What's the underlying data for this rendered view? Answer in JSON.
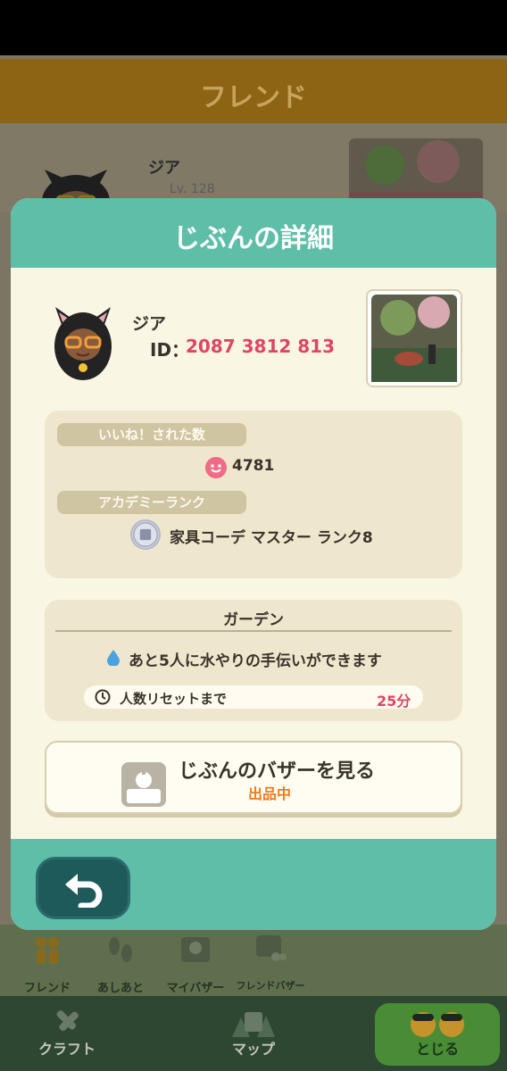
{
  "background": {
    "header_title": "フレンド",
    "friend": {
      "name": "ジア",
      "level": "Lv. 128"
    },
    "tabs": [
      {
        "label": "フレンド",
        "icon": "friends-icon"
      },
      {
        "label": "あしあと",
        "icon": "footprints-icon"
      },
      {
        "label": "マイバザー",
        "icon": "bazaar-icon"
      },
      {
        "label": "フレンドバザー",
        "icon": "friend-bazaar-icon"
      }
    ],
    "bottom_nav": [
      {
        "label": "クラフト",
        "icon": "craft-icon"
      },
      {
        "label": "マップ",
        "icon": "map-icon"
      },
      {
        "label": "とじる",
        "icon": "close-characters-icon"
      }
    ]
  },
  "modal": {
    "title": "じぶんの詳細",
    "profile": {
      "name": "ジア",
      "id_label": "ID：",
      "id_value": "2087 3812 813"
    },
    "likes": {
      "label": "いいね！された数",
      "value": "4781"
    },
    "academy": {
      "label": "アカデミーランク",
      "rank_text": "家具コーデ マスター ランク8"
    },
    "garden": {
      "title": "ガーデン",
      "water_text": "あと5人に水やりの手伝いができます",
      "reset_label": "人数リセットまで",
      "reset_value": "25分"
    },
    "bazaar": {
      "label": "じぶんのバザーを見る",
      "status": "出品中"
    }
  },
  "colors": {
    "accent": "#5ebea8",
    "highlight": "#e04564",
    "orange": "#f07c1a",
    "panel": "#efe7cd"
  }
}
